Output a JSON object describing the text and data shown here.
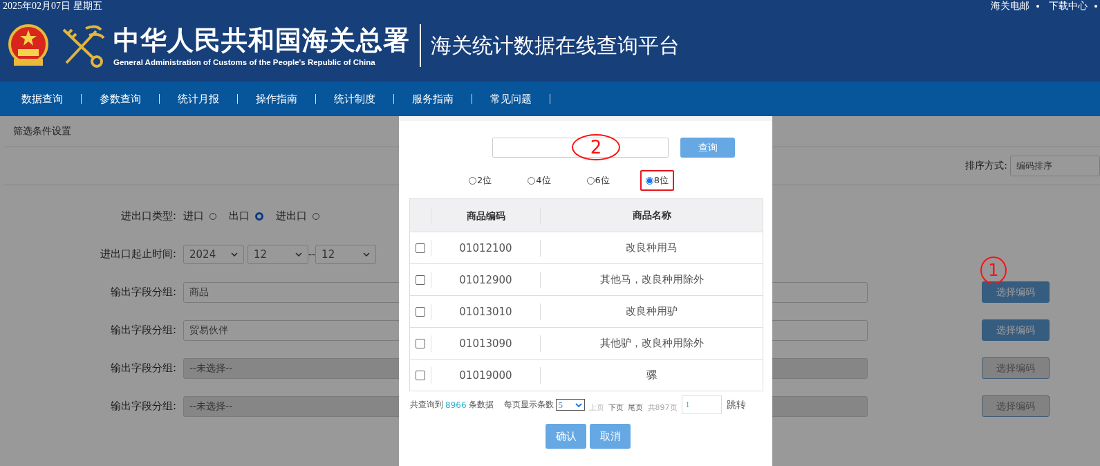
{
  "top_bar": {
    "date": "2025年02月07日 星期五",
    "links": [
      "海关电邮",
      "下载中心"
    ]
  },
  "header": {
    "title_cn": "中华人民共和国海关总署",
    "title_en": "General Administration of Customs of the People's Republic of China",
    "platform": "海关统计数据在线查询平台"
  },
  "nav": [
    "数据查询",
    "参数查询",
    "统计月报",
    "操作指南",
    "统计制度",
    "服务指南",
    "常见问题"
  ],
  "panel": {
    "title": "筛选条件设置",
    "sort_label": "排序方式:",
    "sort_value": "编码排序"
  },
  "form": {
    "trade_type": {
      "label": "进出口类型:",
      "options": [
        {
          "label": "进口",
          "selected": false
        },
        {
          "label": "出口",
          "selected": true
        },
        {
          "label": "进出口",
          "selected": false
        }
      ]
    },
    "period": {
      "label": "进出口起止时间:",
      "year": "2024",
      "from": "12",
      "separator": "--",
      "to": "12"
    },
    "groups": [
      {
        "label": "输出字段分组:",
        "value": "商品",
        "disabled": false,
        "button": "选择编码"
      },
      {
        "label": "输出字段分组:",
        "value": "贸易伙伴",
        "disabled": false,
        "button": "选择编码"
      },
      {
        "label": "输出字段分组:",
        "value": "--未选择--",
        "disabled": true,
        "button": "选择编码"
      },
      {
        "label": "输出字段分组:",
        "value": "--未选择--",
        "disabled": true,
        "button": "选择编码"
      }
    ]
  },
  "dialog": {
    "search_button": "查询",
    "digits": [
      {
        "label": "2位",
        "selected": false,
        "highlighted": false
      },
      {
        "label": "4位",
        "selected": false,
        "highlighted": false
      },
      {
        "label": "6位",
        "selected": false,
        "highlighted": false
      },
      {
        "label": "8位",
        "selected": true,
        "highlighted": true
      }
    ],
    "table": {
      "columns": [
        "商品编码",
        "商品名称"
      ],
      "rows": [
        {
          "code": "01012100",
          "name": "改良种用马",
          "checked": false
        },
        {
          "code": "01012900",
          "name": "其他马，改良种用除外",
          "checked": false
        },
        {
          "code": "01013010",
          "name": "改良种用驴",
          "checked": false
        },
        {
          "code": "01013090",
          "name": "其他驴，改良种用除外",
          "checked": false
        },
        {
          "code": "01019000",
          "name": "骡",
          "checked": false
        }
      ]
    },
    "pager": {
      "total_prefix": "共查询到",
      "total_count": "8966",
      "total_suffix": "条数据",
      "per_page_label": "每页显示条数",
      "per_page": "5",
      "links": [
        {
          "label": "上页",
          "disabled": true
        },
        {
          "label": "下页",
          "disabled": false
        },
        {
          "label": "尾页",
          "disabled": false
        }
      ],
      "pages": "共897页",
      "page_input": "1",
      "jump": "跳转"
    },
    "buttons": [
      "确认",
      "取消"
    ]
  },
  "annotations": [
    {
      "kind": "circle",
      "label": "1"
    },
    {
      "kind": "circle",
      "label": "2"
    }
  ]
}
